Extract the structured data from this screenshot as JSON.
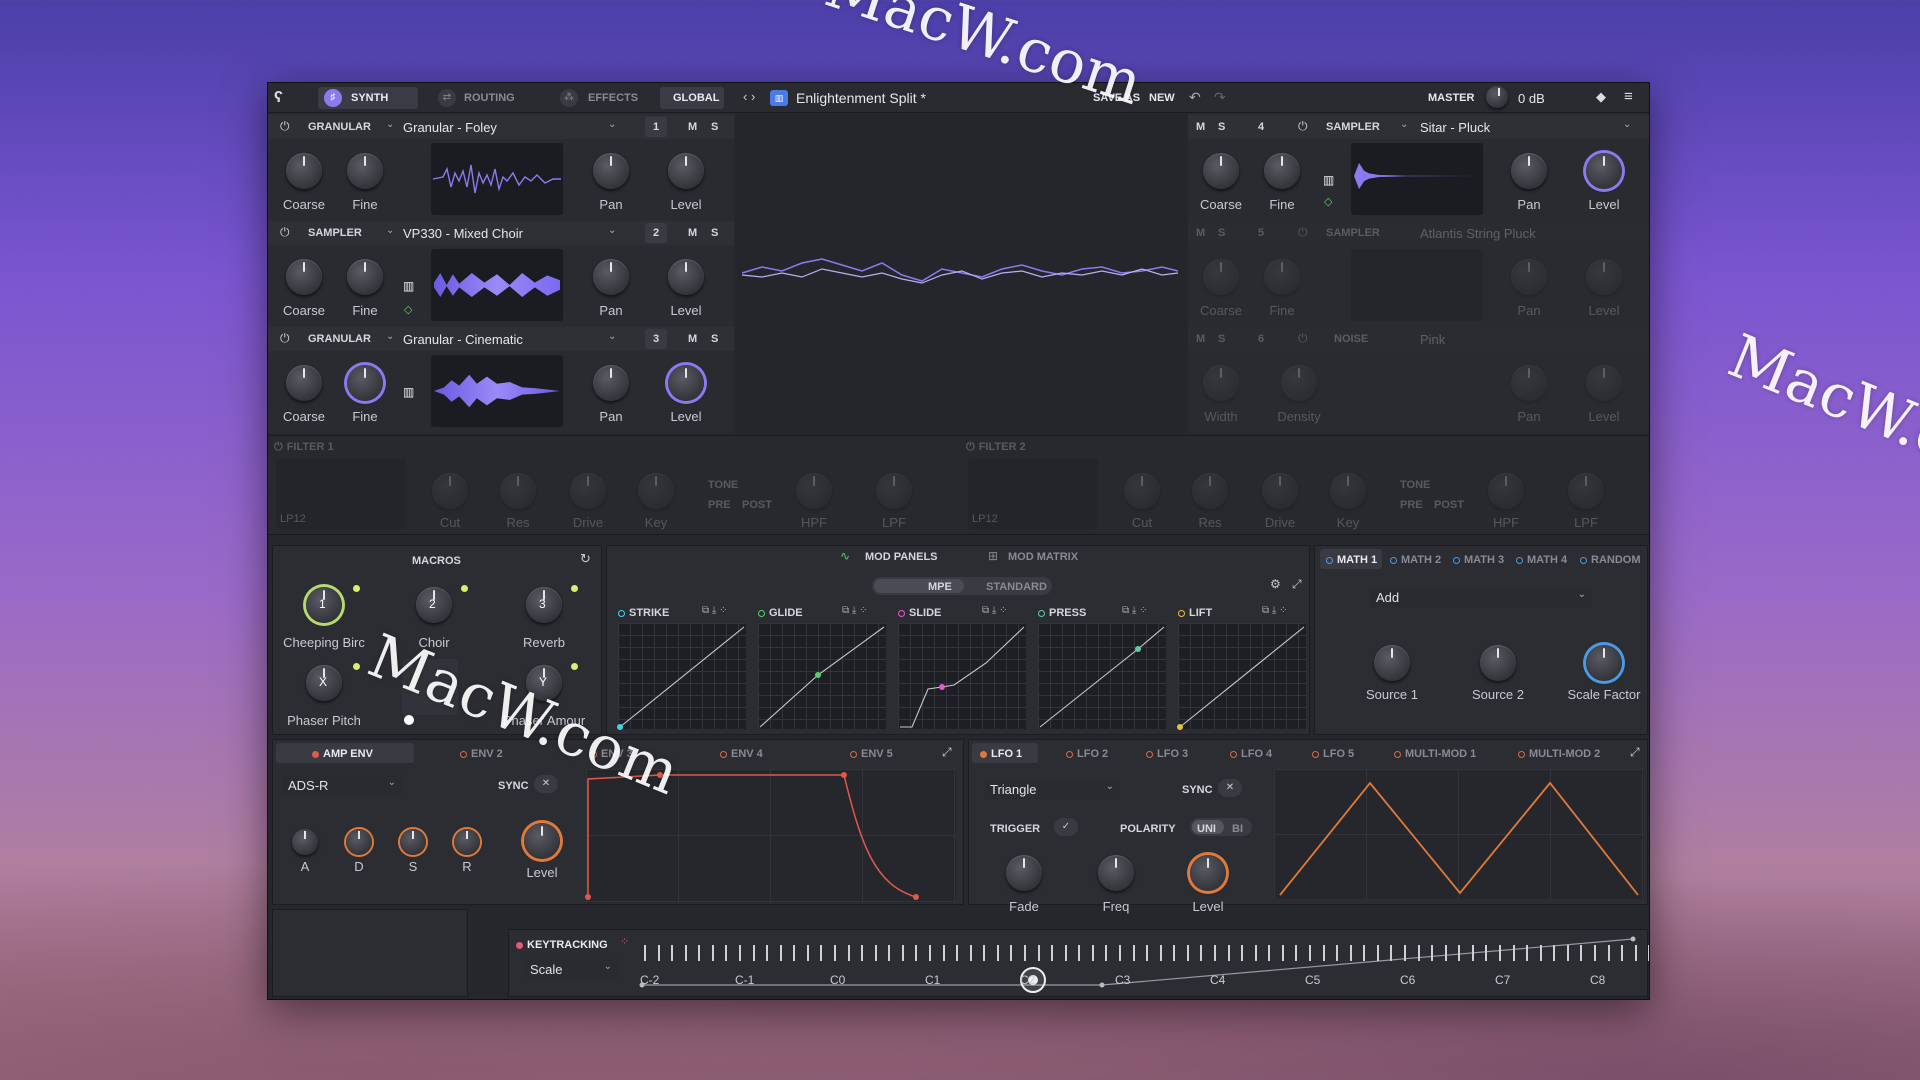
{
  "header": {
    "tabs": [
      "SYNTH",
      "ROUTING",
      "EFFECTS",
      "GLOBAL"
    ],
    "preset": "Enlightenment Split *",
    "save_as": "SAVE AS",
    "new": "NEW",
    "master_label": "MASTER",
    "master_value": "0 dB"
  },
  "sources": [
    {
      "type": "GRANULAR",
      "preset": "Granular - Foley",
      "num": "1"
    },
    {
      "type": "SAMPLER",
      "preset": "VP330 - Mixed Choir",
      "num": "2"
    },
    {
      "type": "GRANULAR",
      "preset": "Granular - Cinematic",
      "num": "3"
    }
  ],
  "sources_right": [
    {
      "type": "SAMPLER",
      "preset": "Sitar - Pluck",
      "num": "4"
    },
    {
      "type": "SAMPLER",
      "preset": "Atlantis String Pluck",
      "num": "5"
    },
    {
      "type": "NOISE",
      "preset": "Pink",
      "num": "6"
    }
  ],
  "knobs": {
    "coarse": "Coarse",
    "fine": "Fine",
    "pan": "Pan",
    "level": "Level",
    "width": "Width",
    "density": "Density"
  },
  "m": "M",
  "s": "S",
  "filters": [
    {
      "title": "FILTER 1",
      "type": "LP12",
      "cut": "Cut",
      "res": "Res",
      "drive": "Drive",
      "key": "Key",
      "tone": "TONE",
      "pre": "PRE",
      "post": "POST",
      "hpf": "HPF",
      "lpf": "LPF"
    },
    {
      "title": "FILTER 2",
      "type": "LP12",
      "cut": "Cut",
      "res": "Res",
      "drive": "Drive",
      "key": "Key",
      "tone": "TONE",
      "pre": "PRE",
      "post": "POST",
      "hpf": "HPF",
      "lpf": "LPF"
    }
  ],
  "macros": {
    "title": "MACROS",
    "items": [
      {
        "num": "1",
        "label": "Cheeping Birc"
      },
      {
        "num": "2",
        "label": "Choir"
      },
      {
        "num": "3",
        "label": "Reverb"
      },
      {
        "num": "X",
        "label": "Phaser Pitch"
      },
      {
        "num": "Y",
        "label": "Phaser Amour"
      }
    ]
  },
  "mod": {
    "panels": "MOD PANELS",
    "matrix": "MOD MATRIX",
    "mpe": "MPE",
    "standard": "STANDARD",
    "curves": [
      "STRIKE",
      "GLIDE",
      "SLIDE",
      "PRESS",
      "LIFT"
    ]
  },
  "math": {
    "tabs": [
      "MATH 1",
      "MATH 2",
      "MATH 3",
      "MATH 4",
      "RANDOM"
    ],
    "mode": "Add",
    "knobs": [
      "Source 1",
      "Source 2",
      "Scale Factor"
    ]
  },
  "env": {
    "tabs": [
      "AMP ENV",
      "ENV 2",
      "ENV 3",
      "ENV 4",
      "ENV 5"
    ],
    "mode": "ADS-R",
    "sync": "SYNC",
    "knobs": [
      "A",
      "D",
      "S",
      "R"
    ],
    "level": "Level"
  },
  "lfo": {
    "tabs": [
      "LFO 1",
      "LFO 2",
      "LFO 3",
      "LFO 4",
      "LFO 5",
      "MULTI-MOD 1",
      "MULTI-MOD 2"
    ],
    "shape": "Triangle",
    "sync": "SYNC",
    "trigger": "TRIGGER",
    "polarity": "POLARITY",
    "uni": "UNI",
    "bi": "BI",
    "knobs": [
      "Fade",
      "Freq",
      "Level"
    ]
  },
  "keytracking": {
    "title": "KEYTRACKING",
    "mode": "Scale",
    "notes": [
      "C-2",
      "C-1",
      "C0",
      "C1",
      "C2",
      "C3",
      "C4",
      "C5",
      "C6",
      "C7",
      "C8"
    ]
  },
  "watermark": "MacW.com",
  "colors": {
    "accent": "#8a7af0",
    "lfo": "#e07a3a",
    "env": "#e05a4a",
    "math": "#4a9ae6"
  }
}
